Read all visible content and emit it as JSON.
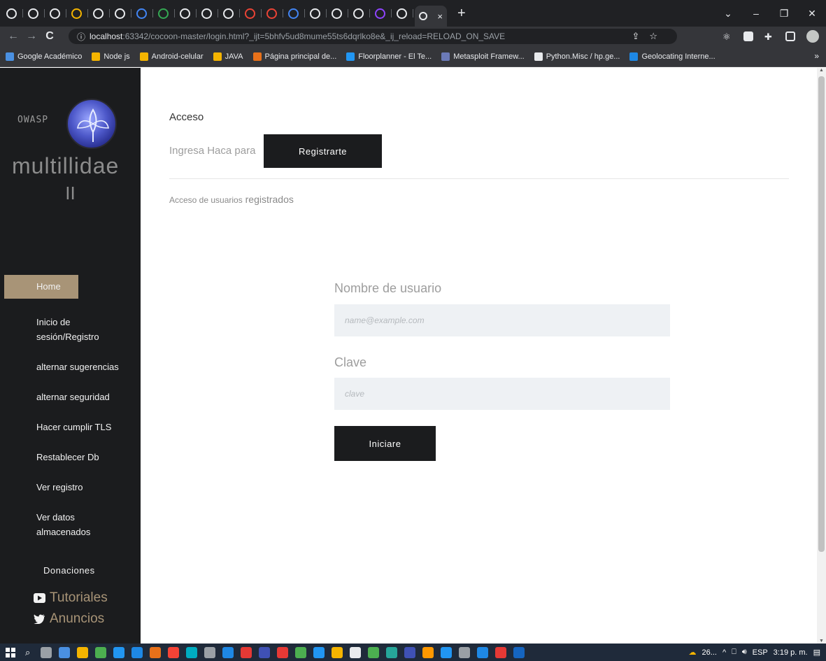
{
  "browser": {
    "tabs_count": 19,
    "active_tab_close": "×",
    "new_tab": "+",
    "window_controls": [
      "⌄",
      "–",
      "❐",
      "✕"
    ],
    "url_host": "localhost",
    "url_rest": ":63342/cocoon-master/login.html?_ijt=5bhfv5ud8mume55ts6dqrlko8e&_ij_reload=RELOAD_ON_SAVE",
    "bookmarks": [
      {
        "label": "Google Académico",
        "color": "#4a90e2"
      },
      {
        "label": "Node js",
        "color": "#f4b400"
      },
      {
        "label": "Android-celular",
        "color": "#f4b400"
      },
      {
        "label": "JAVA",
        "color": "#f4b400"
      },
      {
        "label": "Página principal de...",
        "color": "#e8711a"
      },
      {
        "label": "Floorplanner - El Te...",
        "color": "#2196f3"
      },
      {
        "label": "Metasploit Framew...",
        "color": "#6b7ab8"
      },
      {
        "label": "Python.Misc / hp.ge...",
        "color": "#e8eaed"
      },
      {
        "label": "Geolocating Interne...",
        "color": "#1e88e5"
      }
    ],
    "bookmarks_more": "»"
  },
  "sidebar": {
    "owasp_label": "OWASP",
    "brand_line1": "multillidae",
    "brand_line2": "II",
    "menu": [
      {
        "label": "Home"
      },
      {
        "label": "Inicio de"
      },
      {
        "label": "sesión/Registro"
      },
      {
        "label": "alternar sugerencias"
      },
      {
        "label": "alternar seguridad"
      },
      {
        "label": "Hacer cumplir TLS"
      },
      {
        "label": "Restablecer Db"
      },
      {
        "label": "Ver registro"
      },
      {
        "label": "Ver datos"
      },
      {
        "label": "almacenados"
      }
    ],
    "donaciones": "Donaciones",
    "tutoriales": "Tutoriales",
    "anuncios": "Anuncios"
  },
  "main": {
    "title": "Acceso",
    "ingresa": "Ingresa Haca para",
    "register_button": "Registrarte",
    "subhead_small": "Acceso de usuarios",
    "subhead_rest": "registrados",
    "username_label": "Nombre de usuario",
    "username_placeholder": "name@example.com",
    "password_label": "Clave",
    "password_placeholder": "clave",
    "login_button": "Iniciare"
  },
  "taskbar": {
    "weather": "26...",
    "language": "ESP",
    "time": "3:19 p. m."
  },
  "colors": {
    "sidebar_bg": "#1b1c1e",
    "accent": "#a89477",
    "button_bg": "#1b1c1e",
    "field_bg": "#eef1f4"
  }
}
